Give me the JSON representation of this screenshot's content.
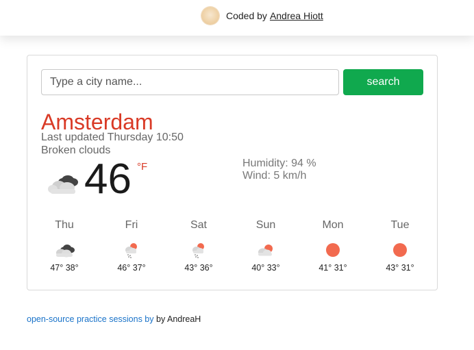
{
  "header": {
    "credit_prefix": "Coded by",
    "author_link": "Andrea Hiott"
  },
  "search": {
    "placeholder": "Type a city name...",
    "value": "",
    "button_label": "search"
  },
  "current": {
    "city": "Amsterdam",
    "last_updated": "Last updated Thursday 10:50",
    "description": "Broken clouds",
    "temperature": "46",
    "unit": "°F",
    "humidity": "Humidity: 94 %",
    "wind": "Wind: 5 km/h",
    "icon": "broken-clouds-icon"
  },
  "forecast": [
    {
      "day": "Thu",
      "temps": "47° 38°",
      "icon": "broken-clouds-icon"
    },
    {
      "day": "Fri",
      "temps": "46° 37°",
      "icon": "rain-sun-icon"
    },
    {
      "day": "Sat",
      "temps": "43° 36°",
      "icon": "rain-sun-icon"
    },
    {
      "day": "Sun",
      "temps": "40° 33°",
      "icon": "partly-cloudy-icon"
    },
    {
      "day": "Mon",
      "temps": "41° 31°",
      "icon": "sun-icon"
    },
    {
      "day": "Tue",
      "temps": "43° 31°",
      "icon": "sun-icon"
    }
  ],
  "footer": {
    "link_text": "open-source practice sessions by",
    "suffix": "by AndreaH"
  },
  "colors": {
    "accent_red": "#d93a26",
    "button_green": "#10a94e",
    "link_blue": "#1a73c9",
    "sun": "#f26a4f"
  }
}
